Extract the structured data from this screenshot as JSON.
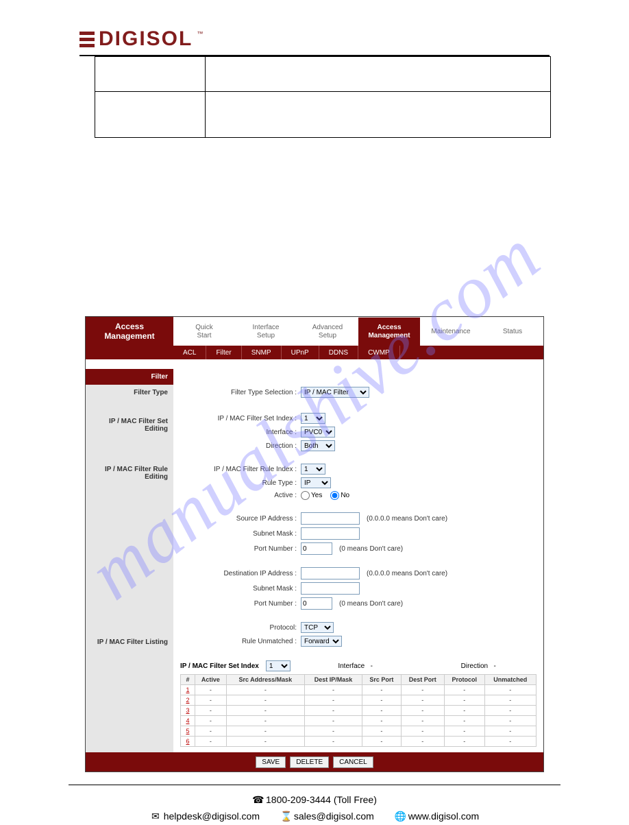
{
  "logo": {
    "text": "DIGISOL",
    "tm": "™"
  },
  "watermark": "manualshive.com",
  "nav1": {
    "title_line1": "Access",
    "title_line2": "Management",
    "items": [
      {
        "label_line1": "Quick",
        "label_line2": "Start"
      },
      {
        "label_line1": "Interface",
        "label_line2": "Setup"
      },
      {
        "label_line1": "Advanced",
        "label_line2": "Setup"
      },
      {
        "label_line1": "Access",
        "label_line2": "Management",
        "active": true
      },
      {
        "label_line1": "Maintenance",
        "label_line2": ""
      },
      {
        "label_line1": "Status",
        "label_line2": ""
      }
    ]
  },
  "nav2": {
    "items": [
      "ACL",
      "Filter",
      "SNMP",
      "UPnP",
      "DDNS",
      "CWMP"
    ]
  },
  "sections": {
    "filter_head": "Filter",
    "filter_type": "Filter Type",
    "set_editing": "IP / MAC Filter Set Editing",
    "rule_editing": "IP / MAC Filter Rule Editing",
    "filter_listing": "IP / MAC Filter Listing"
  },
  "labels": {
    "filter_type_sel": "Filter Type Selection :",
    "set_index": "IP / MAC Filter Set Index :",
    "interface": "Interface :",
    "direction": "Direction :",
    "rule_index": "IP / MAC Filter Rule Index :",
    "rule_type": "Rule Type :",
    "active": "Active :",
    "active_yes": "Yes",
    "active_no": "No",
    "src_ip": "Source IP Address :",
    "subnet": "Subnet Mask :",
    "port": "Port Number :",
    "dst_ip": "Destination IP Address :",
    "protocol": "Protocol:",
    "unmatched": "Rule Unmatched :",
    "hint_ip": "(0.0.0.0 means Don't care)",
    "hint_port": "(0 means Don't care)",
    "listing_setindex": "IP / MAC Filter Set Index",
    "listing_interface": "Interface",
    "listing_direction": "Direction"
  },
  "values": {
    "filter_type_sel": "IP / MAC Filter",
    "set_index": "1",
    "interface": "PVC0",
    "direction": "Both",
    "rule_index": "1",
    "rule_type": "IP",
    "active": "No",
    "src_ip": "",
    "src_mask": "",
    "src_port": "0",
    "dst_ip": "",
    "dst_mask": "",
    "dst_port": "0",
    "protocol": "TCP",
    "unmatched": "Forward",
    "listing_setindex": "1",
    "listing_interface": "-",
    "listing_direction": "-"
  },
  "listing": {
    "headers": [
      "#",
      "Active",
      "Src Address/Mask",
      "Dest IP/Mask",
      "Src Port",
      "Dest Port",
      "Protocol",
      "Unmatched"
    ],
    "rows": [
      {
        "n": "1",
        "cells": [
          "-",
          "-",
          "-",
          "-",
          "-",
          "-",
          "-"
        ]
      },
      {
        "n": "2",
        "cells": [
          "-",
          "-",
          "-",
          "-",
          "-",
          "-",
          "-"
        ]
      },
      {
        "n": "3",
        "cells": [
          "-",
          "-",
          "-",
          "-",
          "-",
          "-",
          "-"
        ]
      },
      {
        "n": "4",
        "cells": [
          "-",
          "-",
          "-",
          "-",
          "-",
          "-",
          "-"
        ]
      },
      {
        "n": "5",
        "cells": [
          "-",
          "-",
          "-",
          "-",
          "-",
          "-",
          "-"
        ]
      },
      {
        "n": "6",
        "cells": [
          "-",
          "-",
          "-",
          "-",
          "-",
          "-",
          "-"
        ]
      }
    ]
  },
  "buttons": {
    "save": "SAVE",
    "delete": "DELETE",
    "cancel": "CANCEL"
  },
  "footer": {
    "phone": "1800-209-3444 (Toll Free)",
    "helpdesk": "helpdesk@digisol.com",
    "sales": "sales@digisol.com",
    "web": "www.digisol.com"
  }
}
